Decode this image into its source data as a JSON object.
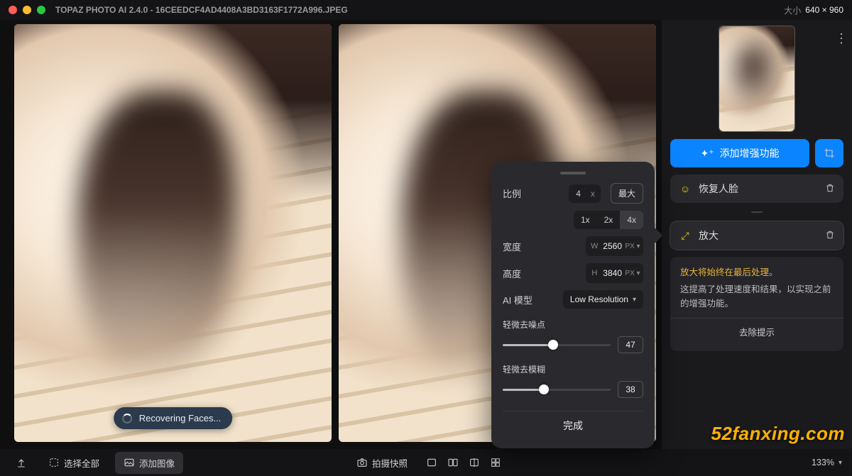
{
  "titlebar": {
    "app_title": "TOPAZ PHOTO AI 2.4.0 - 16CEEDCF4AD4408A3BD3163F1772A996.JPEG",
    "size_label": "大小",
    "size_value": "640 × 960"
  },
  "viewer": {
    "status_toast": "Recovering Faces..."
  },
  "settings_panel": {
    "ratio_label": "比例",
    "ratio_value": "4",
    "ratio_x": "x",
    "ratio_max": "最大",
    "multipliers": [
      "1x",
      "2x",
      "4x"
    ],
    "multiplier_selected": "4x",
    "width_label": "宽度",
    "width_prefix": "W",
    "width_value": "2560",
    "width_unit": "PX ▾",
    "height_label": "高度",
    "height_prefix": "H",
    "height_value": "3840",
    "height_unit": "PX ▾",
    "model_label": "AI 模型",
    "model_value": "Low Resolution",
    "denoise_label": "轻微去噪点",
    "denoise_value": "47",
    "deblur_label": "轻微去模糊",
    "deblur_value": "38",
    "done_label": "完成"
  },
  "sidebar": {
    "add_enhance_label": "添加增强功能",
    "face_recover_label": "恢复人脸",
    "enlarge_label": "放大",
    "info_title": "放大将始终在最后处理。",
    "info_body": "这提高了处理速度和结果，以实现之前的增强功能。",
    "info_dismiss": "去除提示"
  },
  "bottombar": {
    "select_all": "选择全部",
    "add_images": "添加图像",
    "snapshot": "拍摄快照",
    "zoom_value": "133%"
  },
  "watermark": "52fanxing.com"
}
